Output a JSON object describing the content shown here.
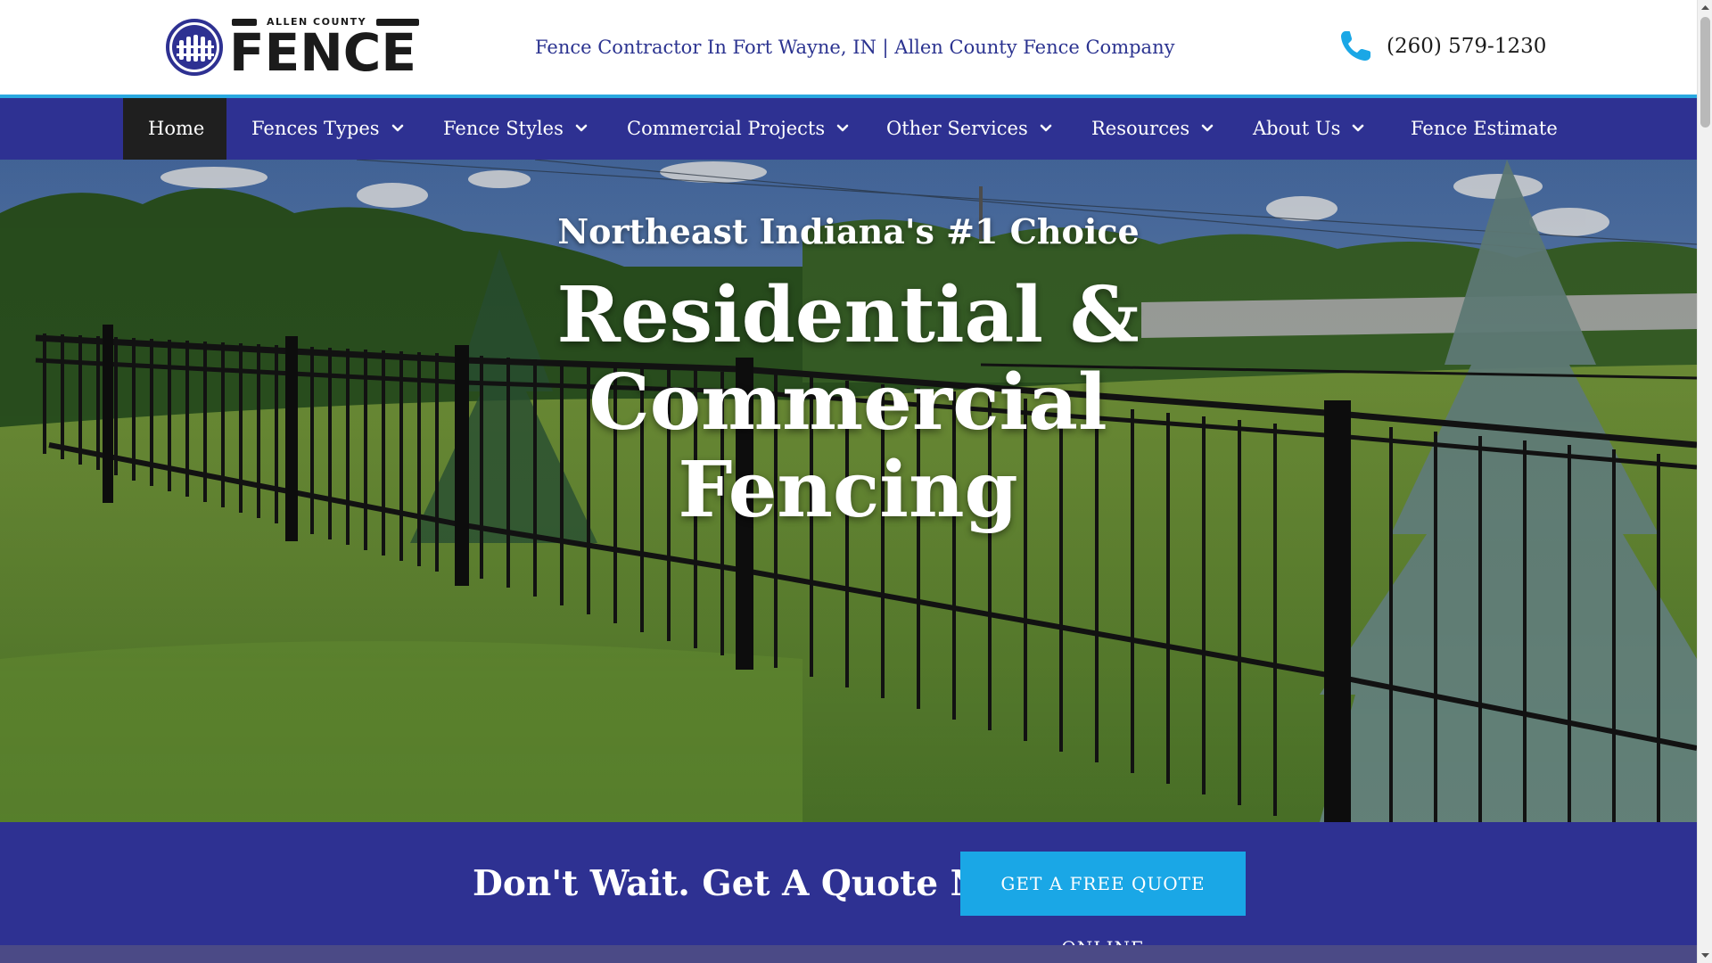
{
  "colors": {
    "brand_navy": "#2e3192",
    "accent_blue": "#29a8e0",
    "cta_blue": "#1aa7e6",
    "active_nav": "#1f1f1f",
    "tagline": "#2b3390"
  },
  "header": {
    "logo": {
      "small_text": "ALLEN COUNTY",
      "big_text": "FENCE",
      "icon": "fence-emblem-icon"
    },
    "tagline": "Fence Contractor In Fort Wayne, IN | Allen County Fence Company",
    "phone": {
      "icon": "phone-icon",
      "number": "(260) 579-1230"
    }
  },
  "nav": {
    "items": [
      {
        "label": "Home",
        "active": true,
        "has_dropdown": false
      },
      {
        "label": "Fences Types",
        "active": false,
        "has_dropdown": true
      },
      {
        "label": "Fence Styles",
        "active": false,
        "has_dropdown": true
      },
      {
        "label": "Commercial Projects",
        "active": false,
        "has_dropdown": true
      },
      {
        "label": "Other Services",
        "active": false,
        "has_dropdown": true
      },
      {
        "label": "Resources",
        "active": false,
        "has_dropdown": true
      },
      {
        "label": "About Us",
        "active": false,
        "has_dropdown": true
      },
      {
        "label": "Fence Estimate",
        "active": false,
        "has_dropdown": false
      }
    ]
  },
  "hero": {
    "subtitle": "Northeast Indiana's #1 Choice",
    "title_line1": "Residential & Commercial",
    "title_line2": "Fencing"
  },
  "cta": {
    "text": "Don't Wait. Get A Quote Now!",
    "button_label": "GET A FREE QUOTE ONLINE"
  }
}
